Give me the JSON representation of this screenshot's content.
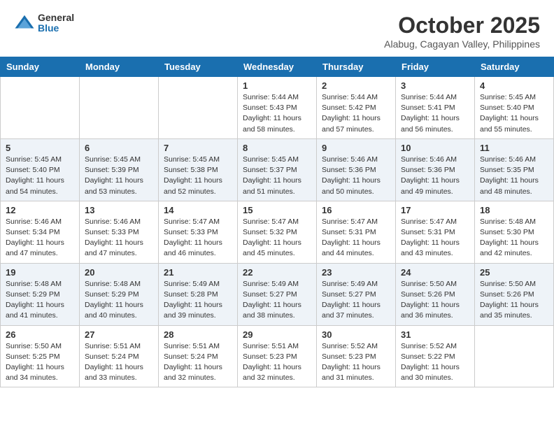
{
  "header": {
    "logo_general": "General",
    "logo_blue": "Blue",
    "month_title": "October 2025",
    "location": "Alabug, Cagayan Valley, Philippines"
  },
  "weekdays": [
    "Sunday",
    "Monday",
    "Tuesday",
    "Wednesday",
    "Thursday",
    "Friday",
    "Saturday"
  ],
  "weeks": [
    [
      {
        "day": "",
        "info": ""
      },
      {
        "day": "",
        "info": ""
      },
      {
        "day": "",
        "info": ""
      },
      {
        "day": "1",
        "info": "Sunrise: 5:44 AM\nSunset: 5:43 PM\nDaylight: 11 hours\nand 58 minutes."
      },
      {
        "day": "2",
        "info": "Sunrise: 5:44 AM\nSunset: 5:42 PM\nDaylight: 11 hours\nand 57 minutes."
      },
      {
        "day": "3",
        "info": "Sunrise: 5:44 AM\nSunset: 5:41 PM\nDaylight: 11 hours\nand 56 minutes."
      },
      {
        "day": "4",
        "info": "Sunrise: 5:45 AM\nSunset: 5:40 PM\nDaylight: 11 hours\nand 55 minutes."
      }
    ],
    [
      {
        "day": "5",
        "info": "Sunrise: 5:45 AM\nSunset: 5:40 PM\nDaylight: 11 hours\nand 54 minutes."
      },
      {
        "day": "6",
        "info": "Sunrise: 5:45 AM\nSunset: 5:39 PM\nDaylight: 11 hours\nand 53 minutes."
      },
      {
        "day": "7",
        "info": "Sunrise: 5:45 AM\nSunset: 5:38 PM\nDaylight: 11 hours\nand 52 minutes."
      },
      {
        "day": "8",
        "info": "Sunrise: 5:45 AM\nSunset: 5:37 PM\nDaylight: 11 hours\nand 51 minutes."
      },
      {
        "day": "9",
        "info": "Sunrise: 5:46 AM\nSunset: 5:36 PM\nDaylight: 11 hours\nand 50 minutes."
      },
      {
        "day": "10",
        "info": "Sunrise: 5:46 AM\nSunset: 5:36 PM\nDaylight: 11 hours\nand 49 minutes."
      },
      {
        "day": "11",
        "info": "Sunrise: 5:46 AM\nSunset: 5:35 PM\nDaylight: 11 hours\nand 48 minutes."
      }
    ],
    [
      {
        "day": "12",
        "info": "Sunrise: 5:46 AM\nSunset: 5:34 PM\nDaylight: 11 hours\nand 47 minutes."
      },
      {
        "day": "13",
        "info": "Sunrise: 5:46 AM\nSunset: 5:33 PM\nDaylight: 11 hours\nand 47 minutes."
      },
      {
        "day": "14",
        "info": "Sunrise: 5:47 AM\nSunset: 5:33 PM\nDaylight: 11 hours\nand 46 minutes."
      },
      {
        "day": "15",
        "info": "Sunrise: 5:47 AM\nSunset: 5:32 PM\nDaylight: 11 hours\nand 45 minutes."
      },
      {
        "day": "16",
        "info": "Sunrise: 5:47 AM\nSunset: 5:31 PM\nDaylight: 11 hours\nand 44 minutes."
      },
      {
        "day": "17",
        "info": "Sunrise: 5:47 AM\nSunset: 5:31 PM\nDaylight: 11 hours\nand 43 minutes."
      },
      {
        "day": "18",
        "info": "Sunrise: 5:48 AM\nSunset: 5:30 PM\nDaylight: 11 hours\nand 42 minutes."
      }
    ],
    [
      {
        "day": "19",
        "info": "Sunrise: 5:48 AM\nSunset: 5:29 PM\nDaylight: 11 hours\nand 41 minutes."
      },
      {
        "day": "20",
        "info": "Sunrise: 5:48 AM\nSunset: 5:29 PM\nDaylight: 11 hours\nand 40 minutes."
      },
      {
        "day": "21",
        "info": "Sunrise: 5:49 AM\nSunset: 5:28 PM\nDaylight: 11 hours\nand 39 minutes."
      },
      {
        "day": "22",
        "info": "Sunrise: 5:49 AM\nSunset: 5:27 PM\nDaylight: 11 hours\nand 38 minutes."
      },
      {
        "day": "23",
        "info": "Sunrise: 5:49 AM\nSunset: 5:27 PM\nDaylight: 11 hours\nand 37 minutes."
      },
      {
        "day": "24",
        "info": "Sunrise: 5:50 AM\nSunset: 5:26 PM\nDaylight: 11 hours\nand 36 minutes."
      },
      {
        "day": "25",
        "info": "Sunrise: 5:50 AM\nSunset: 5:26 PM\nDaylight: 11 hours\nand 35 minutes."
      }
    ],
    [
      {
        "day": "26",
        "info": "Sunrise: 5:50 AM\nSunset: 5:25 PM\nDaylight: 11 hours\nand 34 minutes."
      },
      {
        "day": "27",
        "info": "Sunrise: 5:51 AM\nSunset: 5:24 PM\nDaylight: 11 hours\nand 33 minutes."
      },
      {
        "day": "28",
        "info": "Sunrise: 5:51 AM\nSunset: 5:24 PM\nDaylight: 11 hours\nand 32 minutes."
      },
      {
        "day": "29",
        "info": "Sunrise: 5:51 AM\nSunset: 5:23 PM\nDaylight: 11 hours\nand 32 minutes."
      },
      {
        "day": "30",
        "info": "Sunrise: 5:52 AM\nSunset: 5:23 PM\nDaylight: 11 hours\nand 31 minutes."
      },
      {
        "day": "31",
        "info": "Sunrise: 5:52 AM\nSunset: 5:22 PM\nDaylight: 11 hours\nand 30 minutes."
      },
      {
        "day": "",
        "info": ""
      }
    ]
  ]
}
